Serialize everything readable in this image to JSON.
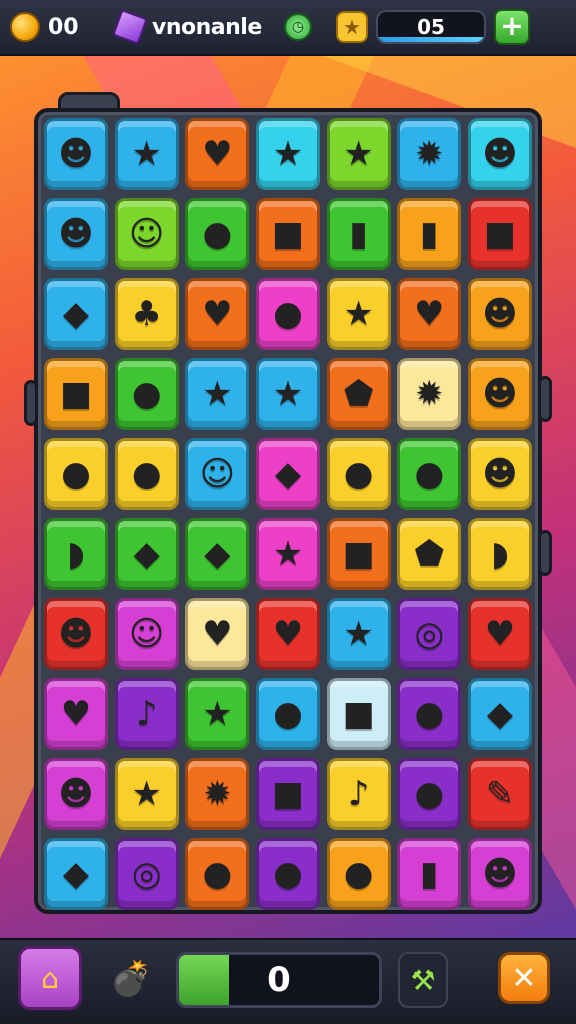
{
  "topbar": {
    "coins": "00",
    "title": "vnonanle",
    "level": "05",
    "plus_label": "+",
    "clock_glyph": "◷",
    "star_glyph": "★"
  },
  "colors": {
    "accent_green": "#3da32c",
    "board_frame": "#3a3f4e",
    "progress_bar": "#3da32c"
  },
  "board": {
    "rows": [
      [
        {
          "color": "blue",
          "glyph": "☻",
          "icon": "purple-cat-face"
        },
        {
          "color": "blue",
          "glyph": "★",
          "icon": "yellow-star"
        },
        {
          "color": "orange",
          "glyph": "♥",
          "icon": "blue-heart"
        },
        {
          "color": "cyan",
          "glyph": "★",
          "icon": "yellow-star"
        },
        {
          "color": "lime",
          "glyph": "★",
          "icon": "yellow-star"
        },
        {
          "color": "blue",
          "glyph": "✹",
          "icon": "orange-sun"
        },
        {
          "color": "cyan",
          "glyph": "☻",
          "icon": "purple-cat-face"
        }
      ],
      [
        {
          "color": "blue",
          "glyph": "☻",
          "icon": "green-cat-face"
        },
        {
          "color": "lime",
          "glyph": "☺",
          "icon": "white-smile-face"
        },
        {
          "color": "green",
          "glyph": "●",
          "icon": "purple-ball-face"
        },
        {
          "color": "orange",
          "glyph": "■",
          "icon": "blue-creature"
        },
        {
          "color": "green",
          "glyph": "▮",
          "icon": "blue-bottle"
        },
        {
          "color": "amber",
          "glyph": "▮",
          "icon": "red-bottle"
        },
        {
          "color": "red",
          "glyph": "■",
          "icon": "gray-creature"
        }
      ],
      [
        {
          "color": "blue",
          "glyph": "◆",
          "icon": "blue-leaf"
        },
        {
          "color": "yellow",
          "glyph": "♣",
          "icon": "orange-blob"
        },
        {
          "color": "orange",
          "glyph": "♥",
          "icon": "pink-heart"
        },
        {
          "color": "pink",
          "glyph": "●",
          "icon": "white-ball-face"
        },
        {
          "color": "yellow",
          "glyph": "★",
          "icon": "green-apple-star"
        },
        {
          "color": "orange",
          "glyph": "♥",
          "icon": "red-heart"
        },
        {
          "color": "amber",
          "glyph": "☻",
          "icon": "bear-face"
        }
      ],
      [
        {
          "color": "amber",
          "glyph": "■",
          "icon": "yellow-block-face"
        },
        {
          "color": "green",
          "glyph": "●",
          "icon": "red-apple"
        },
        {
          "color": "blue",
          "glyph": "★",
          "icon": "yellow-star"
        },
        {
          "color": "blue",
          "glyph": "★",
          "icon": "green-star"
        },
        {
          "color": "orange",
          "glyph": "⬟",
          "icon": "blue-pentagon"
        },
        {
          "color": "cream",
          "glyph": "✹",
          "icon": "orange-sun"
        },
        {
          "color": "amber",
          "glyph": "☻",
          "icon": "green-frog-face"
        }
      ],
      [
        {
          "color": "yellow",
          "glyph": "●",
          "icon": "orange-fruit"
        },
        {
          "color": "yellow",
          "glyph": "●",
          "icon": "green-lemon"
        },
        {
          "color": "blue",
          "glyph": "☺",
          "icon": "yellow-cat-face"
        },
        {
          "color": "pink",
          "glyph": "◆",
          "icon": "orange-leaf"
        },
        {
          "color": "yellow",
          "glyph": "●",
          "icon": "pink-apple"
        },
        {
          "color": "green",
          "glyph": "●",
          "icon": "dark-bug"
        },
        {
          "color": "yellow",
          "glyph": "☻",
          "icon": "lion-face"
        }
      ],
      [
        {
          "color": "green",
          "glyph": "◗",
          "icon": "green-pea-pod"
        },
        {
          "color": "green",
          "glyph": "◆",
          "icon": "purple-eggplant"
        },
        {
          "color": "green",
          "glyph": "◆",
          "icon": "orange-gem"
        },
        {
          "color": "pink",
          "glyph": "★",
          "icon": "yellow-star"
        },
        {
          "color": "orange",
          "glyph": "■",
          "icon": "green-box"
        },
        {
          "color": "yellow",
          "glyph": "⬟",
          "icon": "blue-crystal"
        },
        {
          "color": "yellow",
          "glyph": "◗",
          "icon": "purple-pod"
        }
      ],
      [
        {
          "color": "red",
          "glyph": "☻",
          "icon": "pink-pig-face"
        },
        {
          "color": "magenta",
          "glyph": "☺",
          "icon": "orange-creature"
        },
        {
          "color": "cream",
          "glyph": "♥",
          "icon": "purple-heart"
        },
        {
          "color": "red",
          "glyph": "♥",
          "icon": "green-heart"
        },
        {
          "color": "blue",
          "glyph": "★",
          "icon": "orange-starfish"
        },
        {
          "color": "purple",
          "glyph": "◎",
          "icon": "green-swirl"
        },
        {
          "color": "red",
          "glyph": "♥",
          "icon": "green-heart"
        }
      ],
      [
        {
          "color": "magenta",
          "glyph": "♥",
          "icon": "yellow-blob"
        },
        {
          "color": "purple",
          "glyph": "♪",
          "icon": "green-note"
        },
        {
          "color": "green",
          "glyph": "★",
          "icon": "yellow-star"
        },
        {
          "color": "blue",
          "glyph": "●",
          "icon": "green-apple"
        },
        {
          "color": "ice",
          "glyph": "■",
          "icon": "orange-cookie"
        },
        {
          "color": "purple",
          "glyph": "●",
          "icon": "orange-turnip"
        },
        {
          "color": "blue",
          "glyph": "◆",
          "icon": "green-crystal"
        }
      ],
      [
        {
          "color": "magenta",
          "glyph": "☻",
          "icon": "orange-crab-face"
        },
        {
          "color": "yellow",
          "glyph": "★",
          "icon": "yellow-star"
        },
        {
          "color": "orange",
          "glyph": "✹",
          "icon": "red-splat"
        },
        {
          "color": "purple",
          "glyph": "■",
          "icon": "green-square"
        },
        {
          "color": "yellow",
          "glyph": "♪",
          "icon": "red-note"
        },
        {
          "color": "purple",
          "glyph": "●",
          "icon": "green-apple"
        },
        {
          "color": "red",
          "glyph": "✎",
          "icon": "blue-crystal-pen"
        }
      ],
      [
        {
          "color": "blue",
          "glyph": "◆",
          "icon": "green-crystal"
        },
        {
          "color": "purple",
          "glyph": "◎",
          "icon": "yellow-ring"
        },
        {
          "color": "orange",
          "glyph": "●",
          "icon": "yellow-egg"
        },
        {
          "color": "purple",
          "glyph": "●",
          "icon": "white-onion"
        },
        {
          "color": "amber",
          "glyph": "●",
          "icon": "orange-fruit"
        },
        {
          "color": "magenta",
          "glyph": "▮",
          "icon": "yellow-bottle"
        },
        {
          "color": "magenta",
          "glyph": "☻",
          "icon": "dark-creature"
        }
      ]
    ]
  },
  "bottombar": {
    "home_glyph": "⌂",
    "bomb_glyph": "💣",
    "progress_value": "0",
    "progress_fraction": 0.25,
    "hammer_glyph": "⚒",
    "close_glyph": "✕"
  }
}
